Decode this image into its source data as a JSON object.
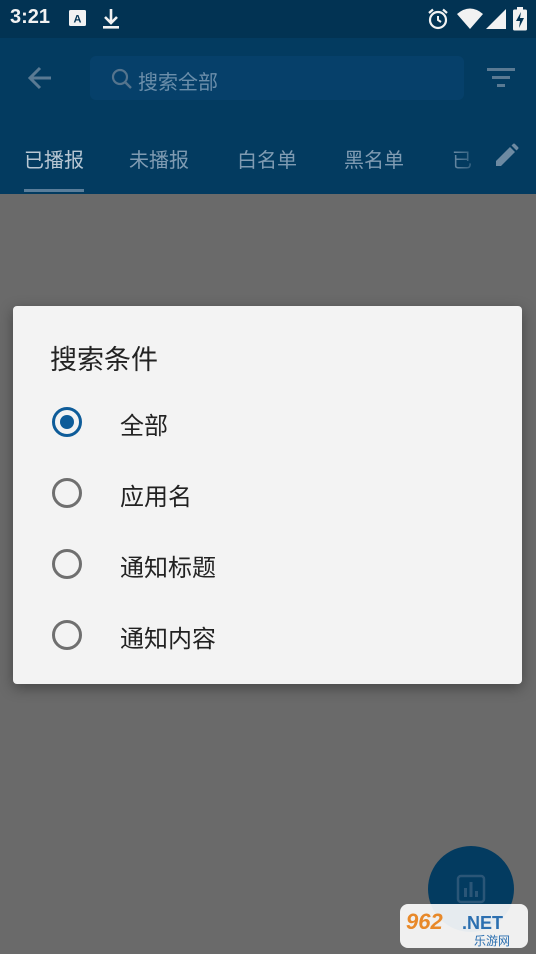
{
  "status_bar": {
    "time": "3:21",
    "left_icons": [
      "a-notification-icon",
      "download-icon"
    ],
    "right_icons": [
      "alarm-icon",
      "wifi-icon",
      "signal-icon",
      "battery-charging-icon"
    ]
  },
  "app_bar": {
    "search_placeholder": "搜索全部",
    "tabs": [
      {
        "label": "已播报"
      },
      {
        "label": "未播报"
      },
      {
        "label": "白名单"
      },
      {
        "label": "黑名单"
      },
      {
        "label": "已"
      }
    ],
    "active_tab_index": 0
  },
  "dialog": {
    "title": "搜索条件",
    "options": [
      {
        "label": "全部",
        "checked": true
      },
      {
        "label": "应用名",
        "checked": false
      },
      {
        "label": "通知标题",
        "checked": false
      },
      {
        "label": "通知内容",
        "checked": false
      }
    ]
  },
  "fab": {
    "icon": "bar-chart-icon"
  },
  "watermark": {
    "brand": "962.NET",
    "sub": "乐游网"
  },
  "colors": {
    "app_bar": "#033b60",
    "status_bar": "#023353",
    "scrim": "#6a6a6a",
    "dialog_bg": "#f3f3f3",
    "accent": "#0e5c99"
  }
}
